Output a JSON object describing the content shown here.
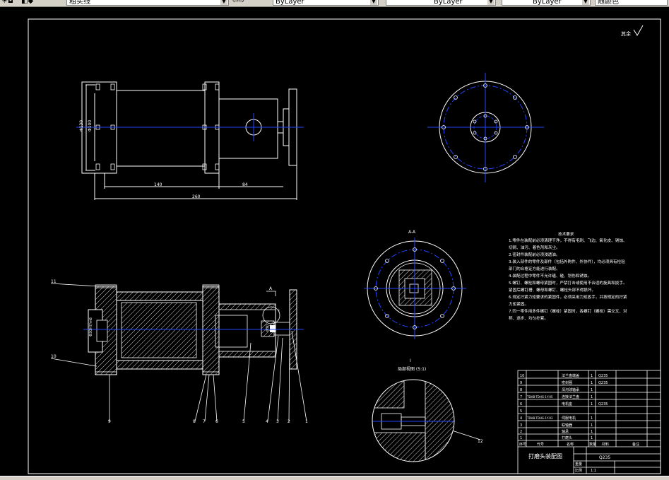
{
  "toolbar": {
    "layer_name": "粗实线",
    "color_value": "ByLayer",
    "linetype_value": "ByLayer",
    "lineweight_value": "ByLayer",
    "plotstyle_value": "随颜色"
  },
  "drawing": {
    "roughness_label": "其余",
    "dims": {
      "d130": "Φ130",
      "d100": "Φ100",
      "l140": "140",
      "l84": "84",
      "l260": "260",
      "fit": "Φ30H7/m6",
      "d30": "Φ30"
    },
    "section_label": "A-A",
    "section_arrow_label": "A",
    "detail_label": "I",
    "detail_title": "局部视图 (5:1)",
    "leader_numbers": [
      "11",
      "10",
      "9",
      "8",
      "7",
      "6",
      "5",
      "4",
      "3",
      "2",
      "1",
      "12"
    ],
    "tech_req": {
      "title": "技术要求",
      "lines": [
        "1.零件在装配前必须清理干净，不得有毛刺、飞边、氧化皮、锈蚀、",
        "切屑、油污、着色剂和灰尘。",
        "2.密封件装配前必须浸透油。",
        "3.装入部件的零件及部件（包括外购件、外协件），均必须具有检验",
        "部门的合格证方能进行装配。",
        "4.装配过程中零件不允许磕、碰、划伤和锈蚀。",
        "5.螺钉、螺栓和螺母紧固时，严禁打击或使用不合适的旋具和扳手。",
        "紧固后螺钉槽、螺母和螺钉、螺栓头部不得损坏。",
        "6.规定拧紧力矩要求的紧固件，必须采用力矩扳手，并按规定的拧紧",
        "力矩紧固。",
        "7.同一零件用多件螺钉（螺栓）紧固时，各螺钉（螺栓）需交叉、对",
        "称、逐步、均匀拧紧。"
      ]
    },
    "title_block": {
      "drawing_name": "打磨头装配图",
      "material": "Q235",
      "scale": "1:1",
      "weight_label": "重量",
      "scale_label": "比例",
      "header": [
        "序号",
        "代号",
        "名称",
        "数量",
        "材料",
        "备注"
      ],
      "rows": [
        {
          "no": "10",
          "code": "",
          "name": "法兰盘端盖",
          "qty": "1",
          "mat": "Q235",
          "note": ""
        },
        {
          "no": "9",
          "code": "",
          "name": "密封圈",
          "qty": "1",
          "mat": "Q235",
          "note": ""
        },
        {
          "no": "8",
          "code": "",
          "name": "深沟球轴承",
          "qty": "1",
          "mat": "",
          "note": ""
        },
        {
          "no": "7",
          "code": "TDHB-TDHG-1Y-05",
          "name": "连接法兰盘",
          "qty": "1",
          "mat": "",
          "note": ""
        },
        {
          "no": "6",
          "code": "",
          "name": "电机座",
          "qty": "1",
          "mat": "Q235",
          "note": ""
        },
        {
          "no": "5",
          "code": "",
          "name": "",
          "qty": "",
          "mat": "",
          "note": ""
        },
        {
          "no": "4",
          "code": "TDHB-TDHG-1Y-03",
          "name": "伺服电机",
          "qty": "1",
          "mat": "",
          "note": ""
        },
        {
          "no": "3",
          "code": "",
          "name": "联轴器",
          "qty": "1",
          "mat": "",
          "note": ""
        },
        {
          "no": "2",
          "code": "",
          "name": "轴承",
          "qty": "1",
          "mat": "",
          "note": ""
        },
        {
          "no": "1",
          "code": "",
          "name": "打磨头",
          "qty": "1",
          "mat": "",
          "note": ""
        }
      ]
    }
  }
}
